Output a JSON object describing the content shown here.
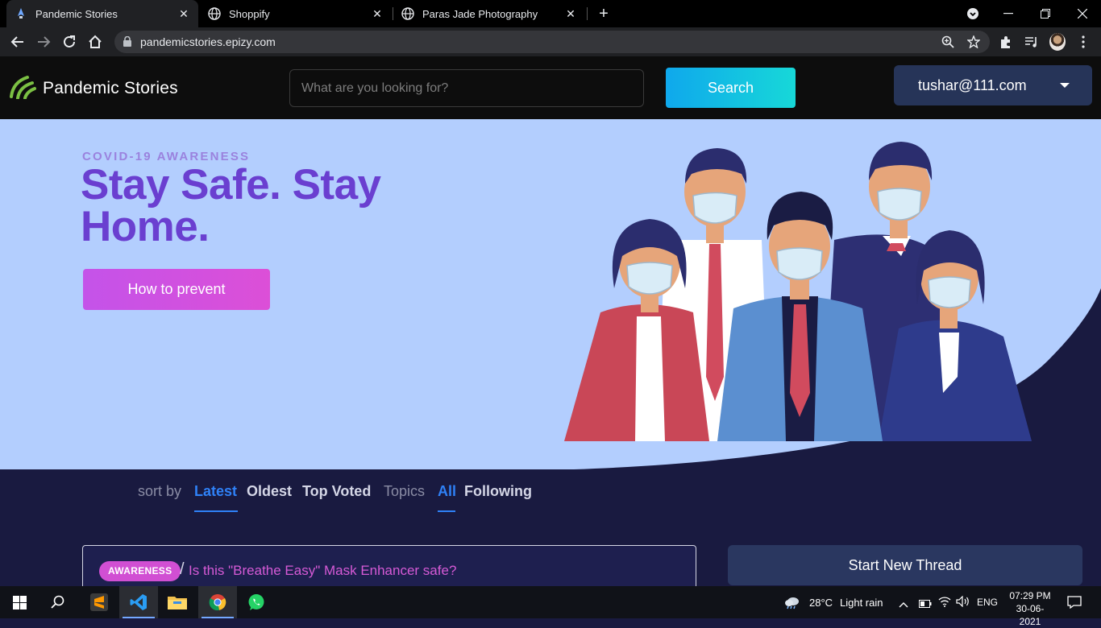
{
  "browser": {
    "tabs": [
      {
        "title": "Pandemic Stories",
        "active": true
      },
      {
        "title": "Shoppify",
        "active": false
      },
      {
        "title": "Paras Jade Photography",
        "active": false
      }
    ],
    "url": "pandemicstories.epizy.com"
  },
  "site": {
    "brand": "Pandemic Stories",
    "search_placeholder": "What are you looking for?",
    "search_button": "Search",
    "user": "tushar@111.com"
  },
  "hero": {
    "eyebrow": "COVID-19 AWARENESS",
    "headline": "Stay Safe. Stay Home.",
    "cta": "How to prevent"
  },
  "sort": {
    "label": "sort by",
    "options": [
      "Latest",
      "Oldest",
      "Top Voted"
    ],
    "active": "Latest",
    "topics_label": "Topics",
    "topics": [
      "All",
      "Following"
    ],
    "active_topic": "All"
  },
  "threads": [
    {
      "tag": "AWARENESS",
      "separator": "/",
      "title": "Is this \"Breathe Easy\" Mask Enhancer safe?"
    }
  ],
  "sidebar": {
    "new_thread": "Start New Thread"
  },
  "taskbar": {
    "weather_temp": "28°C",
    "weather_desc": "Light rain",
    "language": "ENG",
    "time": "07:29 PM",
    "date": "30-06-2021"
  },
  "colors": {
    "hero_bg": "#b3cefe",
    "headline": "#6a3fd0",
    "accent_blue": "#2f81f7",
    "badge": "#d14fd3",
    "dark_bg": "#191a40"
  }
}
